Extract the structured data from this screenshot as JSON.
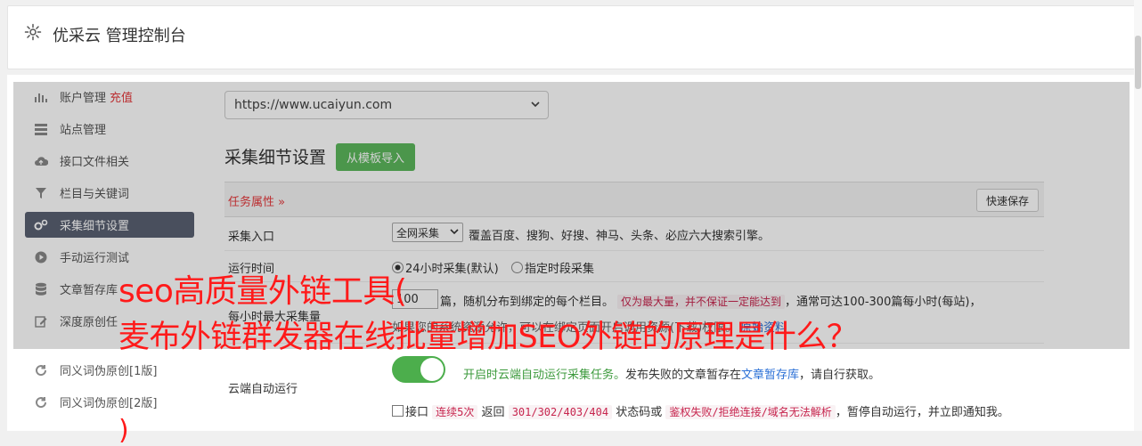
{
  "header": {
    "title": "优采云 管理控制台"
  },
  "sidebar": {
    "items": [
      {
        "label": "账户管理",
        "extra": "充值"
      },
      {
        "label": "站点管理"
      },
      {
        "label": "接口文件相关"
      },
      {
        "label": "栏目与关键词"
      },
      {
        "label": "采集细节设置"
      },
      {
        "label": "手动运行测试"
      },
      {
        "label": "文章暂存库"
      },
      {
        "label": "深度原创任"
      },
      {
        "label": "同义词伪原创[1版]"
      },
      {
        "label": "同义词伪原创[2版]"
      }
    ]
  },
  "main": {
    "site_select": "https://www.ucaiyun.com",
    "section_title": "采集细节设置",
    "template_button": "从模板导入",
    "task_attr": "任务属性 »",
    "quick_save": "快速保存",
    "rows": {
      "entry_label": "采集入口",
      "entry_select": "全网采集",
      "entry_desc": "覆盖百度、搜狗、好搜、神马、头条、必应六大搜索引擎。",
      "time_label": "运行时间",
      "time_opt1": "24小时采集(默认)",
      "time_opt2": "指定时段采集",
      "max_label": "每小时最大采集量",
      "max_value": "100",
      "max_unit": "篇，随机分布到绑定的每个栏目。",
      "max_pill": "仅为最大量，并不保证一定能达到",
      "max_tail": "，通常可达100-300篇每小时(每站)，",
      "max_line2a": "如果您的系统资源允许，可以在绑定页面开启调用资源(下载)权限。",
      "max_line2b": "原始资料",
      "cloud_label": "云端自动运行",
      "cloud_text1": "开启时云端自动运行采集任务。",
      "cloud_text2": "发布失败的文章暂存在",
      "cloud_link": "文章暂存库",
      "cloud_text3": "，请自行获取。",
      "cb_text1": "接口",
      "cb_pill1": "连续5次",
      "cb_text2": "返回",
      "cb_pill2": "301/302/403/404",
      "cb_text3": "状态码或",
      "cb_pill3": "鉴权失败/拒绝连接/域名无法解析",
      "cb_text4": "，暂停自动运行，并立即通知我。"
    }
  },
  "overlay_text": {
    "line1": "seo高质量外链工具(",
    "line2": "麦布外链群发器在线批量增加SEO外链的原理是什么？",
    "line3": ")"
  }
}
